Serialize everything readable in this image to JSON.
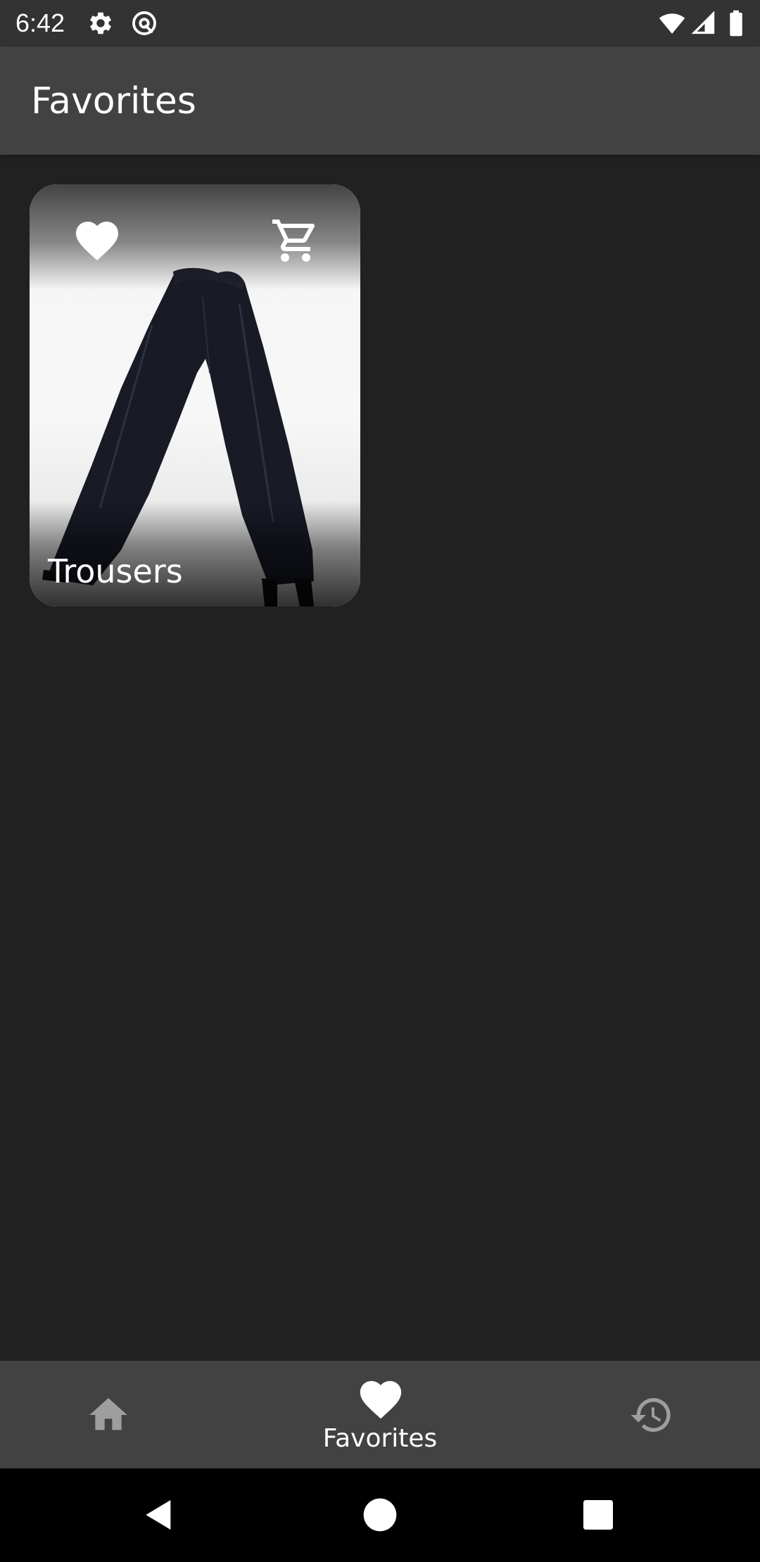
{
  "status_bar": {
    "time": "6:42",
    "icons_left": [
      "gear-icon",
      "at-sign-icon"
    ],
    "icons_right": [
      "wifi-icon",
      "cell-signal-icon",
      "battery-icon"
    ]
  },
  "app_bar": {
    "title": "Favorites"
  },
  "favorites": [
    {
      "title": "Trousers",
      "image": "photo of dark navy trousers on white background",
      "favorite_icon": "heart-icon",
      "cart_icon": "cart-icon",
      "is_favorite": true
    }
  ],
  "bottom_nav": {
    "items": [
      {
        "icon": "home-icon",
        "label": "",
        "selected": false
      },
      {
        "icon": "heart-icon",
        "label": "Favorites",
        "selected": true
      },
      {
        "icon": "history-icon",
        "label": "",
        "selected": false
      }
    ]
  },
  "system_nav": {
    "buttons": [
      "back-icon",
      "home-circle-icon",
      "recents-icon"
    ]
  },
  "colors": {
    "background": "#212121",
    "status_bar": "#333333",
    "app_bar": "#424242",
    "bottom_nav": "#424242",
    "system_nav": "#000000",
    "active_icon": "#ffffff",
    "inactive_icon": "#9e9e9e"
  }
}
